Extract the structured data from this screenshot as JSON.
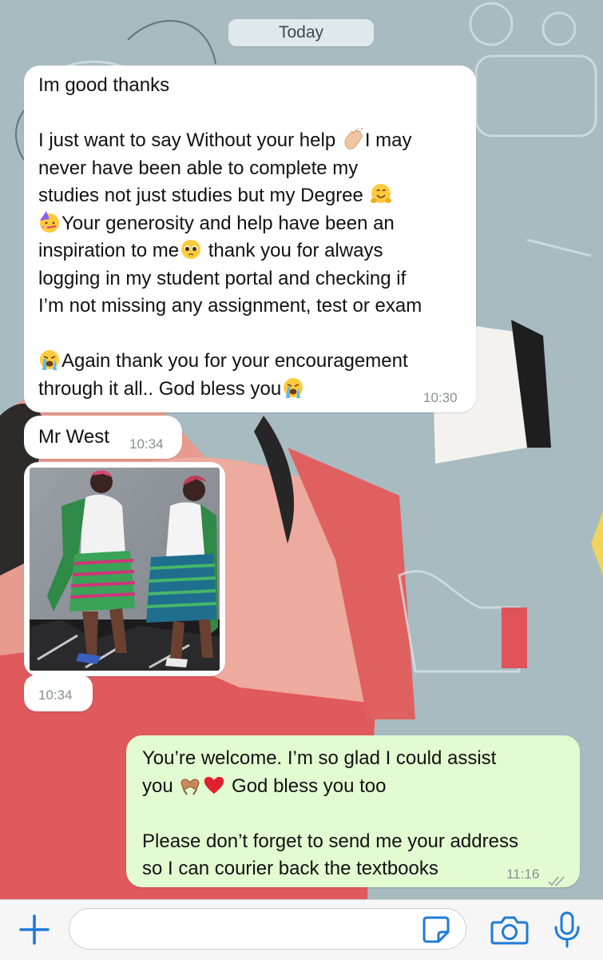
{
  "date_separator": "Today",
  "messages": [
    {
      "type": "text",
      "direction": "incoming",
      "lines": [
        "Im good thanks",
        "",
        "I just want to say Without your help ",
        "never have been able to complete my",
        "studies not just studies but my Degree ",
        "Your generosity and help have been an",
        "inspiration to me",
        "logging in my student portal and checking if",
        "I’m not missing any assignment, test or exam",
        "",
        "Again thank you for your encouragement",
        "through it all.. God bless you"
      ],
      "line3_tail": "I may",
      "line7_tail": " thank you for always",
      "time": "10:30"
    },
    {
      "type": "text",
      "direction": "incoming",
      "text": "Mr West",
      "time": "10:34"
    },
    {
      "type": "image",
      "direction": "incoming",
      "image_description_icon": "photo-two-women-dancing"
    },
    {
      "type": "time-only",
      "direction": "incoming",
      "time": "10:34"
    },
    {
      "type": "text",
      "direction": "outgoing",
      "lines": [
        "You’re welcome. I’m so glad I could assist",
        "you ",
        "",
        "Please don’t forget to send me your address",
        "so I can courier back the textbooks"
      ],
      "line2_tail": " God bless you too",
      "time": "11:16",
      "status": "read-double-check"
    }
  ],
  "emojis": [
    "clapping-hands",
    "hugging-face",
    "partying-face",
    "pleading-face",
    "loudly-crying-face",
    "heart-hands",
    "red-heart"
  ],
  "input_bar": {
    "placeholder": "",
    "value": ""
  },
  "colors": {
    "incoming_bubble": "#ffffff",
    "outgoing_bubble": "#e2fbd1",
    "accent_icon": "#1f7bd9"
  }
}
